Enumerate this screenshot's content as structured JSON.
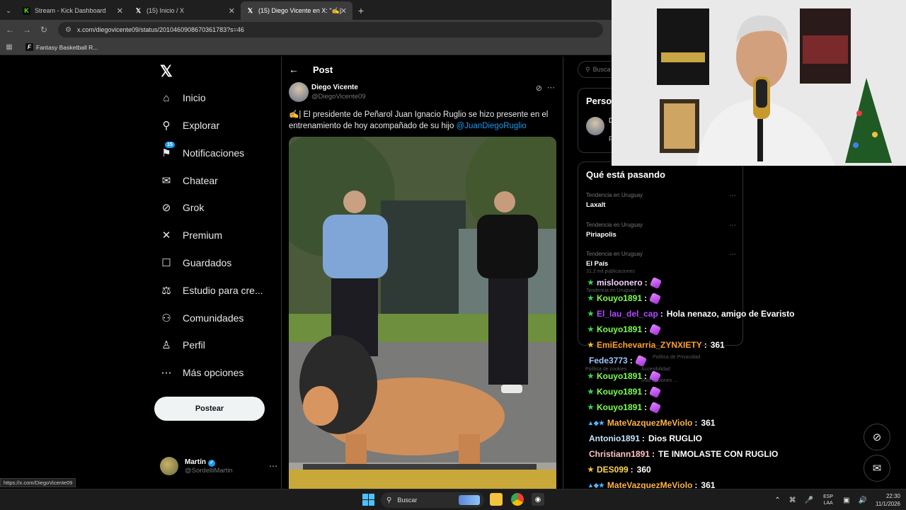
{
  "browser": {
    "tabs": [
      {
        "label": "Stream - Kick Dashboard",
        "icon": "kick-icon",
        "color": "#53fc18"
      },
      {
        "label": "(15) Inicio / X",
        "icon": "x-icon",
        "color": "#ffffff"
      },
      {
        "label": "(15) Diego Vicente en X: \"✍| El ...",
        "icon": "x-icon",
        "color": "#ffffff"
      }
    ],
    "url": "x.com/diegovicente09/status/2010460908670361783?s=46",
    "bookmark": "Fantasy Basketball R...",
    "status_url": "https://x.com/DiegoVicente09"
  },
  "sidebar": {
    "nav": [
      {
        "label": "Inicio",
        "icon": "home-icon",
        "glyph": "⌂"
      },
      {
        "label": "Explorar",
        "icon": "search-icon",
        "glyph": "⚲"
      },
      {
        "label": "Notificaciones",
        "icon": "bell-icon",
        "glyph": "⍾",
        "badge": "15"
      },
      {
        "label": "Chatear",
        "icon": "mail-icon",
        "glyph": "✉"
      },
      {
        "label": "Grok",
        "icon": "grok-icon",
        "glyph": "⊘"
      },
      {
        "label": "Premium",
        "icon": "x-premium-icon",
        "glyph": "✕"
      },
      {
        "label": "Guardados",
        "icon": "bookmark-icon",
        "glyph": "☐"
      },
      {
        "label": "Estudio para cre...",
        "icon": "studio-icon",
        "glyph": "♆"
      },
      {
        "label": "Comunidades",
        "icon": "communities-icon",
        "glyph": "⚇"
      },
      {
        "label": "Perfil",
        "icon": "profile-icon",
        "glyph": "♙"
      },
      {
        "label": "Más opciones",
        "icon": "more-options-icon",
        "glyph": "⋯"
      }
    ],
    "post_button": "Postear",
    "account": {
      "name": "Martín",
      "handle": "@SordelliMartin"
    }
  },
  "post": {
    "header": "Post",
    "author_name": "Diego Vicente",
    "author_handle": "@DiegoVicente09",
    "text": "✍️| El presidente de Peñarol Juan Ignacio Ruglio se hizo presente en el entrenamiento de hoy acompañado de su hijo ",
    "mention": "@JuanDiegoRuglio"
  },
  "right": {
    "search_placeholder": "Busca",
    "persons_header": "Perso",
    "persons_name": "D",
    "persons_sub": "P",
    "trends_header": "Qué está pasando",
    "trends": [
      {
        "context": "Tendencia en Uruguay",
        "title": "Laxalt"
      },
      {
        "context": "Tendencia en Uruguay",
        "title": "Piriapolis"
      },
      {
        "context": "Tendencia en Uruguay",
        "title": "El País"
      }
    ],
    "faint_count": "31.2 mil publicaciones",
    "faint_4": "Tendencia en Uruguay",
    "faint_privacy": "Política de Privacidad",
    "faint_cookies": "Política de cookies",
    "faint_access": "Accesibilidad",
    "faint_more": "Más opciones ..."
  },
  "chat": [
    {
      "user": "misloonero",
      "color": "#f5d0ff",
      "star": true,
      "emote": true,
      "msg": ""
    },
    {
      "user": "Kouyo1891",
      "color": "#7dff4f",
      "star": true,
      "emote": true,
      "msg": ""
    },
    {
      "user": "El_lau_del_cap",
      "color": "#b04cff",
      "star": true,
      "emote": false,
      "msg": "Hola nenazo, amigo de Evaristo"
    },
    {
      "user": "Kouyo1891",
      "color": "#7dff4f",
      "star": true,
      "emote": true,
      "msg": ""
    },
    {
      "user": "EmiEchevarria_ZYNXIETY",
      "color": "#ff9f2e",
      "star": true,
      "emote": false,
      "msg": "361"
    },
    {
      "user": "Fede3773",
      "color": "#9ec4ff",
      "star": false,
      "emote": true,
      "msg": ""
    },
    {
      "user": "Kouyo1891",
      "color": "#7dff4f",
      "star": true,
      "emote": true,
      "msg": ""
    },
    {
      "user": "Kouyo1891",
      "color": "#7dff4f",
      "star": true,
      "emote": true,
      "msg": ""
    },
    {
      "user": "Kouyo1891",
      "color": "#7dff4f",
      "star": true,
      "emote": true,
      "msg": ""
    },
    {
      "user": "MateVazquezMeViolo",
      "color": "#ffb347",
      "star": false,
      "emote": false,
      "badges": true,
      "msg": "361"
    },
    {
      "user": "Antonio1891",
      "color": "#c9e3ff",
      "star": false,
      "emote": false,
      "msg": "Dios RUGLIO"
    },
    {
      "user": "Christiann1891",
      "color": "#ffc2c2",
      "star": false,
      "emote": false,
      "msg": "TE INMOLASTE CON RUGLIO"
    },
    {
      "user": "DES099",
      "color": "#ffd84d",
      "star": true,
      "emote": false,
      "msg": "360"
    },
    {
      "user": "MateVazquezMeViolo",
      "color": "#ffb347",
      "star": false,
      "emote": false,
      "badges": true,
      "msg": "361"
    }
  ],
  "taskbar": {
    "search": "Buscar",
    "lang1": "ESP",
    "lang2": "LAA",
    "time": "22:30",
    "date": "11/1/2026"
  }
}
